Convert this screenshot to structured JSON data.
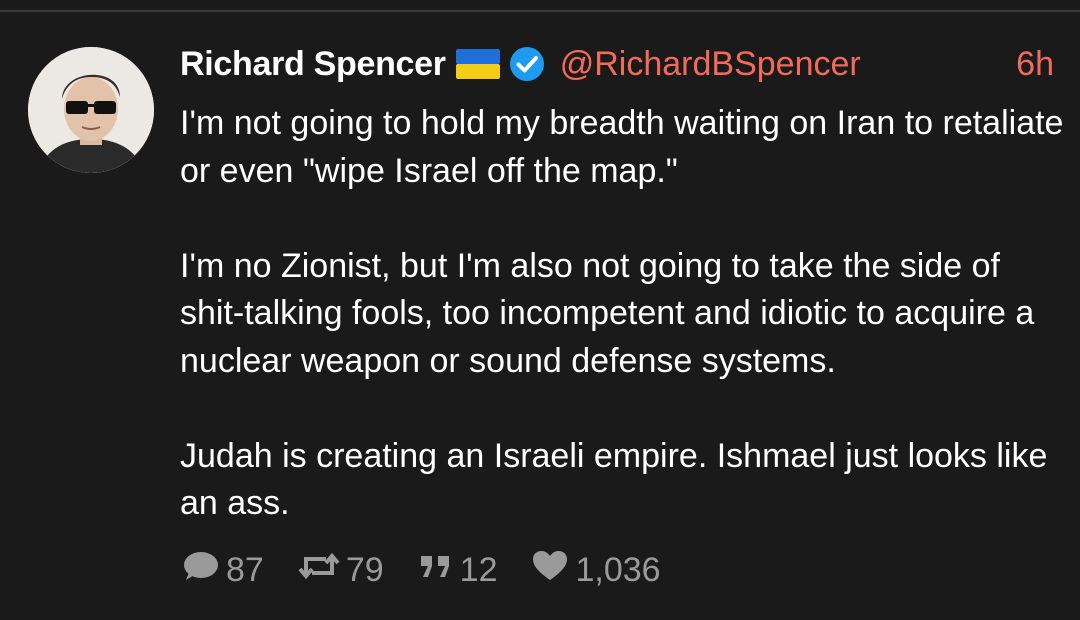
{
  "post": {
    "display_name": "Richard Spencer",
    "flag_icon": "ukraine-flag-icon",
    "verified_icon": "verified-badge-icon",
    "handle": "@RichardBSpencer",
    "time": "6h",
    "paragraphs": [
      "I'm not going to hold my breadth waiting on Iran to retaliate or even \"wipe Israel off the map.\"",
      "I'm no Zionist, but I'm also not going to take the side of shit-talking fools, too incompetent and idiotic to acquire a nuclear weapon or sound defense systems.",
      "Judah is creating an Israeli empire. Ishmael just looks like an ass."
    ],
    "actions": {
      "replies": "87",
      "reposts": "79",
      "quotes": "12",
      "likes": "1,036"
    }
  },
  "colors": {
    "background": "#1a1a1a",
    "text": "#ffffff",
    "accent": "#f26a5a",
    "muted": "#9a9a9a",
    "verified": "#1d9bf0"
  }
}
